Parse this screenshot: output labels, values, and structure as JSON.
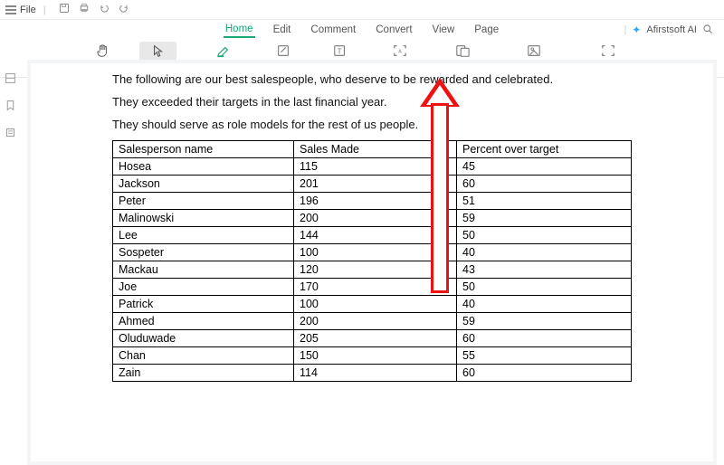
{
  "topbar": {
    "file_label": "File"
  },
  "tabs": {
    "items": [
      "Home",
      "Edit",
      "Comment",
      "Convert",
      "View",
      "Page"
    ],
    "active_index": 0,
    "ai_label": "Afirstsoft AI"
  },
  "ribbon": {
    "hand": "Hand",
    "select": "Select",
    "highlight": "Highlight",
    "edit": "Edit",
    "add_text": "Add Text",
    "ocr": "OCR",
    "to_office": "To Office",
    "to_image": "To Image",
    "full_screen": "Full Screen"
  },
  "document": {
    "paragraphs": [
      "The following are our best salespeople, who deserve to be rewarded and celebrated.",
      "They exceeded their targets in the last financial year.",
      "They should serve as role models for the rest of us people."
    ],
    "table": {
      "headers": [
        "Salesperson name",
        "Sales Made",
        "Percent over target"
      ],
      "rows": [
        [
          "Hosea",
          "115",
          "45"
        ],
        [
          "Jackson",
          "201",
          "60"
        ],
        [
          "Peter",
          "196",
          "51"
        ],
        [
          "Malinowski",
          "200",
          "59"
        ],
        [
          "Lee",
          "144",
          "50"
        ],
        [
          "Sospeter",
          "100",
          "40"
        ],
        [
          "Mackau",
          "120",
          "43"
        ],
        [
          "Joe",
          "170",
          "50"
        ],
        [
          "Patrick",
          "100",
          "40"
        ],
        [
          "Ahmed",
          "200",
          "59"
        ],
        [
          "Oluduwade",
          "205",
          "60"
        ],
        [
          "Chan",
          "150",
          "55"
        ],
        [
          "Zain",
          "114",
          "60"
        ]
      ]
    }
  }
}
